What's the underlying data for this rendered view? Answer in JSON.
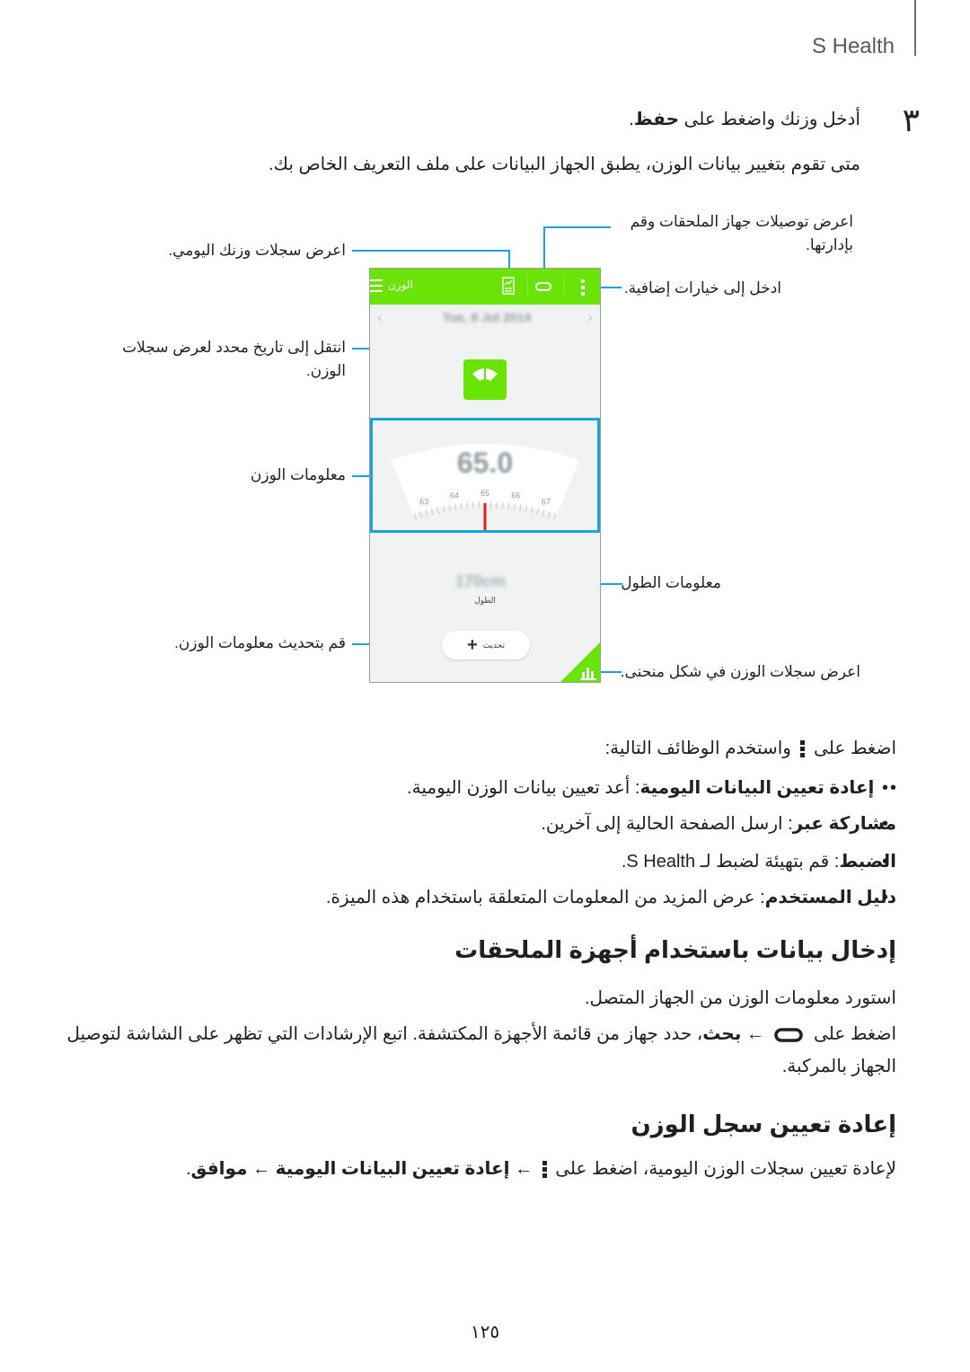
{
  "header": {
    "title": "S Health"
  },
  "step": {
    "number": "٣",
    "text_before": "أدخل وزنك واضغط على ",
    "text_bold": "حفظ",
    "text_after": ".",
    "subtext": "متى تقوم بتغيير بيانات الوزن، يطبق الجهاز البيانات على ملف التعريف الخاص بك."
  },
  "phone": {
    "title": "الوزن",
    "date": "Tue, 8 Jul 2014",
    "weight_value": "65.0",
    "gauge": {
      "ticks": [
        "63",
        "64",
        "65",
        "66",
        "67"
      ],
      "needle_value": 65,
      "colors": {
        "needle": "#e0201c"
      }
    },
    "height_value": "170cm",
    "height_label": "الطول",
    "update_button": "تحديث",
    "icons": [
      "menu-icon",
      "daily-log-icon",
      "accessory-link-icon",
      "more-options-icon",
      "prev-icon",
      "next-icon",
      "scale-icon",
      "plus-icon",
      "graph-icon"
    ],
    "colors": {
      "accent": "#6ae307",
      "callout": "#1aa3dc",
      "background": "#f1f3f3"
    }
  },
  "callouts": {
    "accessories": "اعرض توصيلات جهاز الملحقات وقم بإدارتها.",
    "more_options": "ادخل إلى خيارات إضافية.",
    "daily_log": "اعرض سجلات وزنك اليومي.",
    "date": "انتقل إلى تاريخ محدد لعرض سجلات الوزن.",
    "weight_info": "معلومات الوزن",
    "height_info": "معلومات الطول",
    "update": "قم بتحديث معلومات الوزن.",
    "graph": "اعرض سجلات الوزن في شكل منحنى."
  },
  "options": {
    "intro_before": "اضغط على ",
    "intro_after": " واستخدم الوظائف التالية:",
    "items": [
      {
        "bold": "إعادة تعيين البيانات اليومية",
        "text": ": أعد تعيين بيانات الوزن اليومية."
      },
      {
        "bold": "مشاركة عبر",
        "text": ": ارسل الصفحة الحالية إلى آخرين."
      },
      {
        "bold": "الضبط",
        "text": ": قم بتهيئة لضبط لـ S Health."
      },
      {
        "bold": "دليل المستخدم",
        "text": ": عرض المزيد من المعلومات المتعلقة باستخدام هذه الميزة."
      }
    ]
  },
  "section1": {
    "heading": "إدخال بيانات باستخدام أجهزة الملحقات",
    "line1": "استورد معلومات الوزن من الجهاز المتصل.",
    "line2_before": "اضغط على ",
    "line2_arrow": " ← ",
    "line2_bold": "بحث",
    "line2_after": "، حدد جهاز من قائمة الأجهزة المكتشفة. اتبع الإرشادات التي تظهر على الشاشة لتوصيل",
    "line3": "الجهاز بالمركبة."
  },
  "section2": {
    "heading": "إعادة تعيين سجل الوزن",
    "text_before": "لإعادة تعيين سجلات الوزن اليومية، اضغط على ",
    "arrow1": " ← ",
    "bold1": "إعادة تعيين البيانات اليومية",
    "arrow2": " ← ",
    "bold2": "موافق",
    "text_after": "."
  },
  "page_number": "١٢٥"
}
